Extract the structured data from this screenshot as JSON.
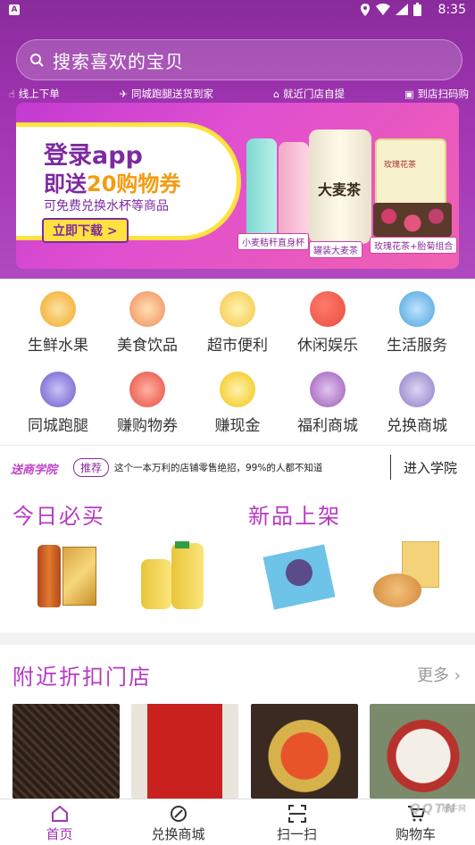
{
  "status": {
    "time": "8:35",
    "app_badge": "A"
  },
  "search": {
    "placeholder": "搜索喜欢的宝贝"
  },
  "features": [
    "线上下单",
    "同城跑腿送货到家",
    "就近门店自提",
    "到店扫码购"
  ],
  "banner": {
    "line1": "登录app",
    "line2_prefix": "即送",
    "line2_highlight": "20购物券",
    "line3": "可免费兑换水杯等商品",
    "button": "立即下载 >",
    "can_label": "大麦茶",
    "box_label": "玫瑰花茶",
    "tags": [
      "小麦秸秆直身杯",
      "罐装大麦茶",
      "玫瑰花茶+胎菊组合"
    ]
  },
  "categories": [
    {
      "label": "生鲜水果",
      "icon": "fruit-icon",
      "color": "#f5a623"
    },
    {
      "label": "美食饮品",
      "icon": "food-drink-icon",
      "color": "#f08a5d"
    },
    {
      "label": "超市便利",
      "icon": "supermarket-icon",
      "color": "#f5c542"
    },
    {
      "label": "休闲娱乐",
      "icon": "ping-pong-icon",
      "color": "#e74c3c"
    },
    {
      "label": "生活服务",
      "icon": "house-icon",
      "color": "#4aa3df"
    },
    {
      "label": "同城跑腿",
      "icon": "delivery-icon",
      "color": "#6a5acd"
    },
    {
      "label": "赚购物券",
      "icon": "coupon-icon",
      "color": "#e74c3c"
    },
    {
      "label": "赚现金",
      "icon": "cash-icon",
      "color": "#f1c40f"
    },
    {
      "label": "福利商城",
      "icon": "cart-icon",
      "color": "#9b59b6"
    },
    {
      "label": "兑换商城",
      "icon": "gift-icon",
      "color": "#8e7cc3"
    }
  ],
  "school": {
    "logo": "送商学院",
    "tag": "推荐",
    "text": "这个一本万利的店铺零售绝招，99%的人都不知道",
    "link": "进入学院"
  },
  "sections": {
    "today": "今日必买",
    "new": "新品上架"
  },
  "nearby": {
    "title": "附近折扣门店",
    "more": "更多"
  },
  "tabs": [
    {
      "label": "首页",
      "icon": "home-icon",
      "active": true
    },
    {
      "label": "兑换商城",
      "icon": "discount-icon",
      "active": false
    },
    {
      "label": "扫一扫",
      "icon": "scan-icon",
      "active": false
    },
    {
      "label": "购物车",
      "icon": "cart-icon",
      "active": false
    }
  ],
  "watermark": {
    "text": "QQTN",
    "subtext": "腾牛网"
  },
  "colors": {
    "brand": "#8a2b9c",
    "accent": "#b739c4"
  }
}
